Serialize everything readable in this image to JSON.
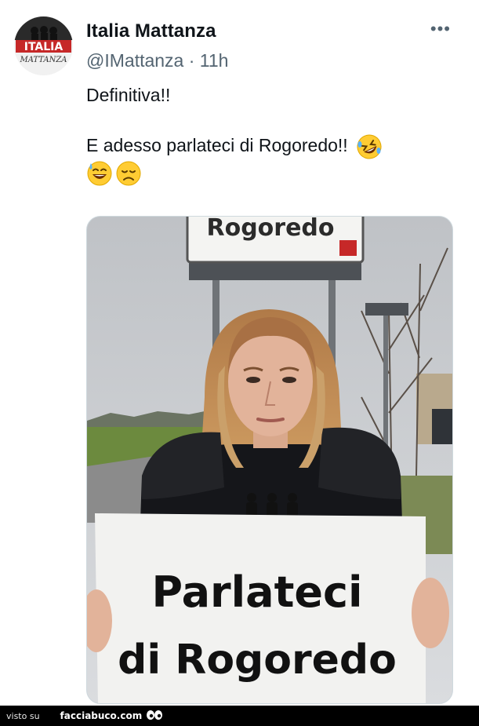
{
  "tweet": {
    "author_name": "Italia Mattanza",
    "handle": "@IMattanza",
    "separator": "·",
    "time": "11h",
    "more_label": "•••",
    "line1": "Definitiva!!",
    "line2": "E adesso parlateci di Rogoredo!!",
    "emojis": [
      "rofl-emoji",
      "grinning-sweat-emoji",
      "disappointed-face-emoji"
    ]
  },
  "avatar": {
    "line1": "ITALIA",
    "line2": "MATTANZA"
  },
  "media": {
    "sign_text": "Rogoredo",
    "placard_line1": "Parlateci",
    "placard_line2": "di Rogoredo"
  },
  "footer": {
    "visto_label": "visto su",
    "brand": "facciabuco.com"
  },
  "colors": {
    "text_primary": "#0f1419",
    "text_secondary": "#536471",
    "footer_bg": "#000000",
    "avatar_red": "#c62828"
  }
}
